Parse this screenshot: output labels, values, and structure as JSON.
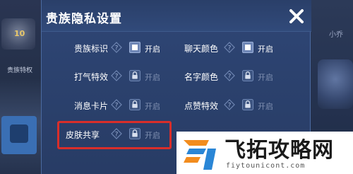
{
  "background": {
    "left_level": "10",
    "left_label": "贵族特权",
    "right_name": "小乔"
  },
  "dialog": {
    "title": "贵族隐私设置",
    "rows_left": [
      {
        "label": "贵族标识",
        "state": "开启",
        "locked": false
      },
      {
        "label": "打气特效",
        "state": "开启",
        "locked": true
      },
      {
        "label": "消息卡片",
        "state": "开启",
        "locked": true
      },
      {
        "label": "皮肤共享",
        "state": "开启",
        "locked": true
      }
    ],
    "rows_right": [
      {
        "label": "聊天颜色",
        "state": "开启",
        "locked": false
      },
      {
        "label": "名字颜色",
        "state": "开启",
        "locked": true
      },
      {
        "label": "点赞特效",
        "state": "开启",
        "locked": true
      }
    ]
  },
  "watermark": {
    "title": "飞拓攻略网",
    "url": "fiytounicont.com"
  },
  "colors": {
    "dialog_bg": "#2b416d",
    "highlight": "#d92e2a",
    "accent_orange": "#f28c1e",
    "accent_blue": "#2a86d6"
  }
}
